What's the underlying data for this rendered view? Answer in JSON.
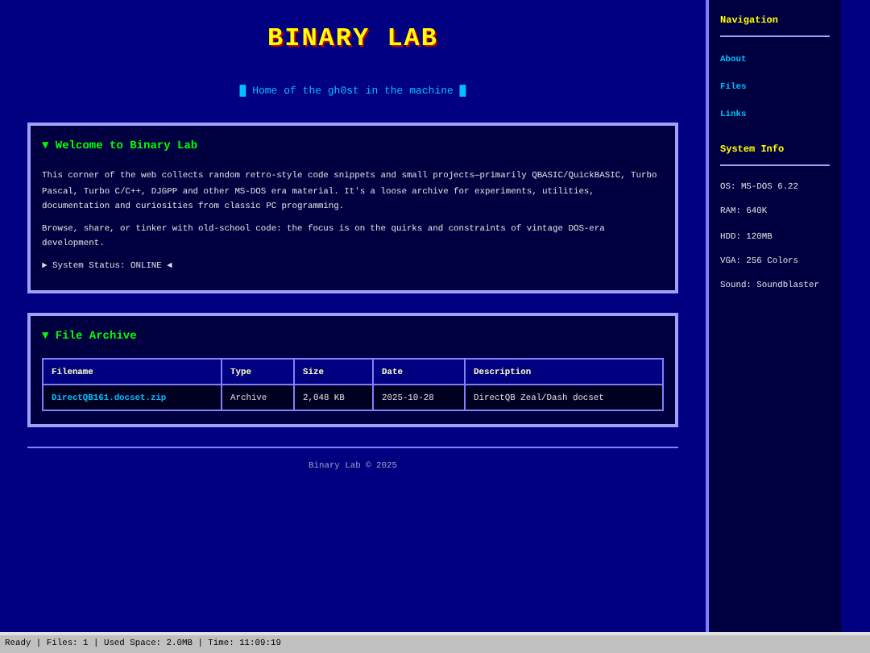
{
  "header": {
    "title": "BINARY LAB",
    "tagline": "█ Home of the gh0st in the machine █"
  },
  "welcome": {
    "heading": "▼ Welcome to Binary Lab",
    "paragraphs": [
      "This corner of the web collects random retro-style code snippets and small projects—primarily QBASIC/QuickBASIC, Turbo Pascal, Turbo C/C++, DJGPP and other MS-DOS era material. It's a loose archive for experiments, utilities, documentation and curiosities from classic PC programming.",
      "Browse, share, or tinker with old-school code: the focus is on the quirks and constraints of vintage DOS-era development."
    ],
    "status": "► System Status: ONLINE ◄"
  },
  "archive": {
    "heading": "▼ File Archive",
    "columns": [
      "Filename",
      "Type",
      "Size",
      "Date",
      "Description"
    ],
    "rows": [
      [
        "DirectQB161.docset.zip",
        "Archive",
        "2,048 KB",
        "2025-10-28",
        "DirectQB Zeal/Dash docset"
      ]
    ]
  },
  "footer": "Binary Lab © 2025",
  "sidebar": {
    "nav_heading": "Navigation",
    "nav_items": [
      "About",
      "Files",
      "Links"
    ],
    "info_heading": "System Info",
    "info_items": [
      "OS: MS-DOS 6.22",
      "RAM: 640K",
      "HDD: 120MB",
      "VGA: 256 Colors",
      "Sound: Soundblaster"
    ]
  },
  "status_bar": "Ready | Files: 1 | Used Space: 2.0MB | Time: 11:09:19"
}
